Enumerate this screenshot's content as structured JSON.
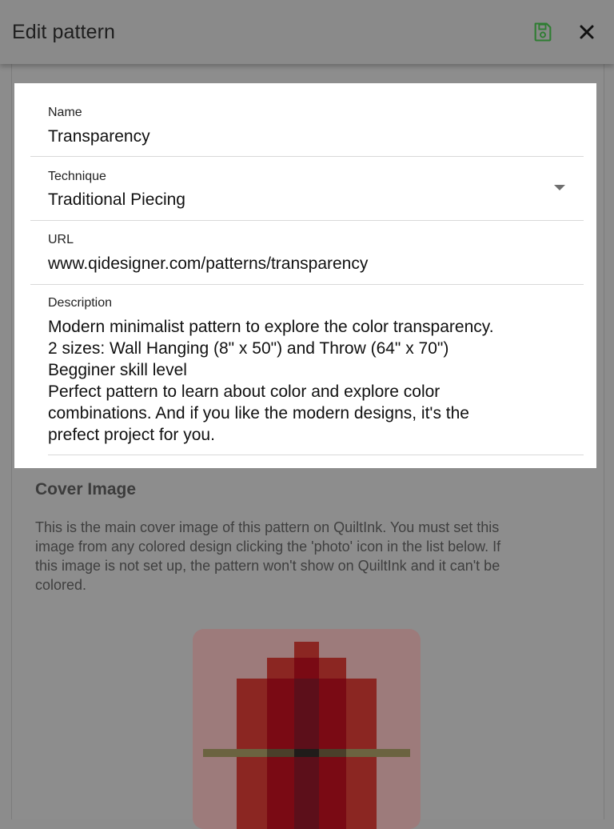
{
  "appbar": {
    "title": "Edit pattern",
    "save_icon": "save-icon",
    "close_icon": "close-icon",
    "accent": "#2e7d32"
  },
  "form": {
    "name": {
      "label": "Name",
      "value": "Transparency"
    },
    "technique": {
      "label": "Technique",
      "value": "Traditional Piecing"
    },
    "url": {
      "label": "URL",
      "value": "www.qidesigner.com/patterns/transparency"
    },
    "description": {
      "label": "Description",
      "lines": [
        "Modern minimalist pattern to explore the color transparency.",
        "2 sizes: Wall Hanging (8\" x 50\") and Throw (64\" x 70\")",
        "Begginer skill level",
        "Perfect pattern to learn about color and explore color",
        "combinations. And if you like the modern designs, it's the",
        "prefect project for you."
      ]
    }
  },
  "cover": {
    "title": "Cover Image",
    "text_lines": [
      "This is the main cover image of this pattern on QuiltInk. You must set this",
      "image from any colored design clicking the 'photo' icon in the list below. If",
      "this image is not set up, the pattern won't show on QuiltInk and it can't be",
      "colored."
    ],
    "image_colors": {
      "background": "#9d7b7b",
      "outer": "#8b2622",
      "mid": "#7a0a14",
      "core": "#5c0f1a",
      "band": "#6b6340",
      "center": "#201c1a"
    }
  }
}
